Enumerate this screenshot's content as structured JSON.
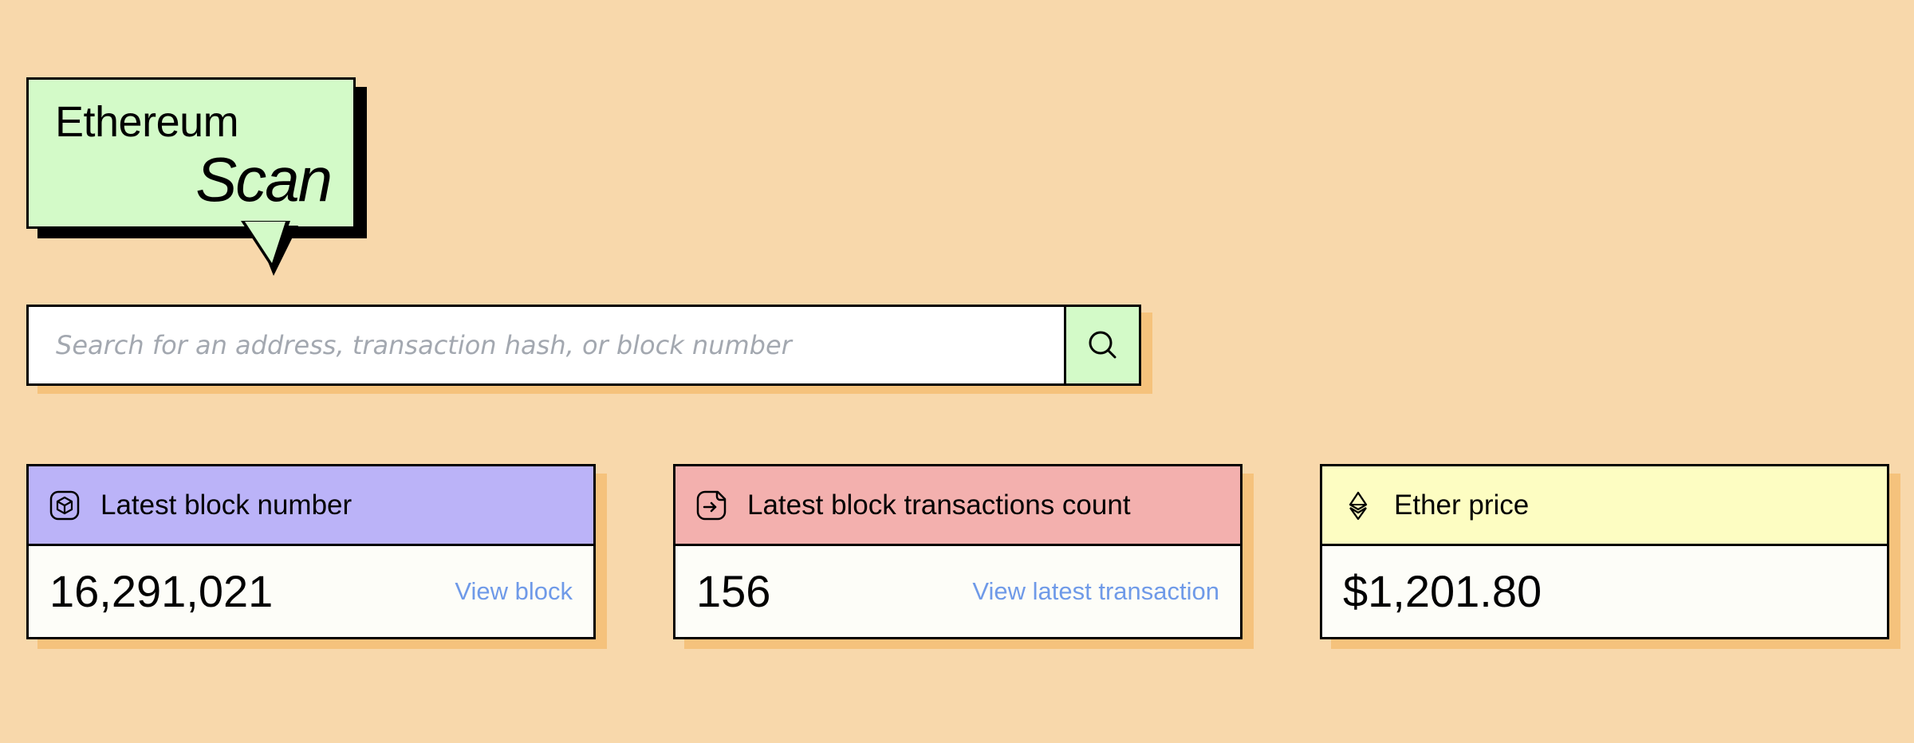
{
  "logo": {
    "line1": "Ethereum",
    "line2": "Scan"
  },
  "search": {
    "placeholder": "Search for an address, transaction hash, or block number",
    "value": "",
    "button_icon": "search-icon"
  },
  "cards": [
    {
      "title": "Latest block number",
      "icon": "cube-icon",
      "value": "16,291,021",
      "link": "View block",
      "header_color": "#bbb3f8"
    },
    {
      "title": "Latest block transactions count",
      "icon": "document-arrow-icon",
      "value": "156",
      "link": "View latest transaction",
      "header_color": "#f3b0ae"
    },
    {
      "title": "Ether price",
      "icon": "ethereum-icon",
      "value": "$1,201.80",
      "link": "",
      "header_color": "#fdfdc2"
    }
  ],
  "colors": {
    "background": "#f8d8ab",
    "logo_bg": "#d3fac8",
    "link": "#6f9ae8",
    "shadow": "#f5c27c"
  }
}
